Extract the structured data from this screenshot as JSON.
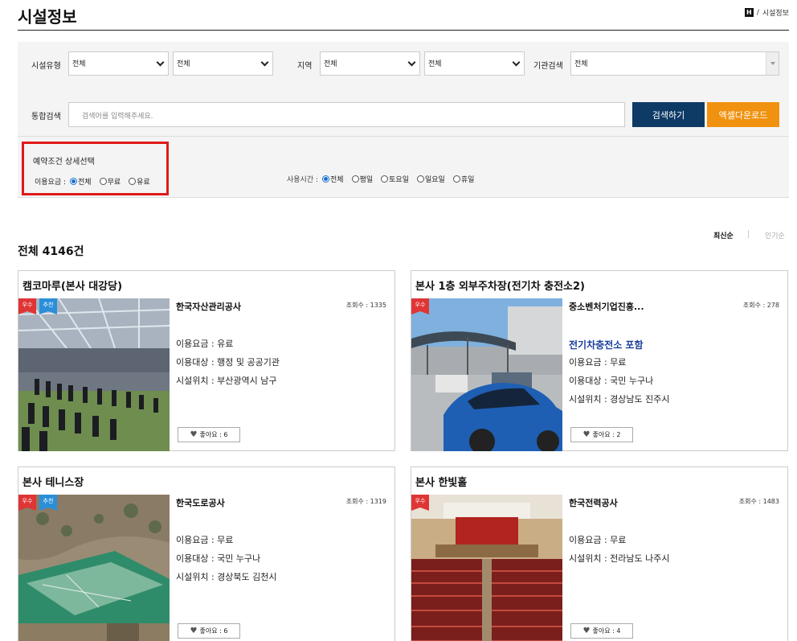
{
  "header": {
    "title": "시설정보",
    "home_label": "H",
    "breadcrumb_sep": "/",
    "breadcrumb_current": "시설정보"
  },
  "filters": {
    "facility_type_label": "시설유형",
    "facility_type_1": "전체",
    "facility_type_2": "전체",
    "region_label": "지역",
    "region_1": "전체",
    "region_2": "전체",
    "org_label": "기관검색",
    "org_value": "전체",
    "search_label": "통합검색",
    "search_placeholder": "검색어를 입력해주세요.",
    "search_button": "검색하기",
    "excel_button": "엑셀다운로드"
  },
  "detail": {
    "title": "예약조건 상세선택",
    "fee_label": "이용요금 :",
    "fee_options": [
      "전체",
      "무료",
      "유료"
    ],
    "fee_selected": 0,
    "time_label": "사용시간 :",
    "time_options": [
      "전체",
      "평일",
      "토요일",
      "일요일",
      "휴일"
    ],
    "time_selected": 0
  },
  "results": {
    "total_label": "전체 4146건",
    "sort_latest": "최신순",
    "sort_popular": "인기순"
  },
  "colors": {
    "navy": "#0e3a66",
    "orange": "#f0920f",
    "highlight_border": "#e01a1a",
    "badge_red": "#e03535",
    "badge_blue": "#2a8fd8"
  },
  "cards": [
    {
      "title": "캠코마루(본사 대강당)",
      "org": "한국자산관리공사",
      "views": "조회수 : 1335",
      "badges": [
        "우수",
        "추천"
      ],
      "highlight": "",
      "info": [
        "이용요금 : 유료",
        "이용대상 : 행정 및 공공기관",
        "시설위치 : 부산광역시 남구"
      ],
      "likes": "좋아요 : 6"
    },
    {
      "title": "본사 1층 외부주차장(전기차 충전소2)",
      "org": "중소벤처기업진흥...",
      "views": "조회수 : 278",
      "badges": [
        "우수"
      ],
      "highlight": "전기차충전소 포함",
      "info": [
        "이용요금 : 무료",
        "이용대상 : 국민 누구나",
        "시설위치 : 경상남도 진주시"
      ],
      "likes": "좋아요 : 2"
    },
    {
      "title": "본사 테니스장",
      "org": "한국도로공사",
      "views": "조회수 : 1319",
      "badges": [
        "우수",
        "추천"
      ],
      "highlight": "",
      "info": [
        "이용요금 : 무료",
        "이용대상 : 국민 누구나",
        "시설위치 : 경상북도 김천시"
      ],
      "likes": "좋아요 : 6"
    },
    {
      "title": "본사 한빛홀",
      "org": "한국전력공사",
      "views": "조회수 : 1483",
      "badges": [
        "우수"
      ],
      "highlight": "",
      "info": [
        "이용요금 : 무료",
        "시설위치 : 전라남도 나주시"
      ],
      "likes": "좋아요 : 4"
    }
  ]
}
